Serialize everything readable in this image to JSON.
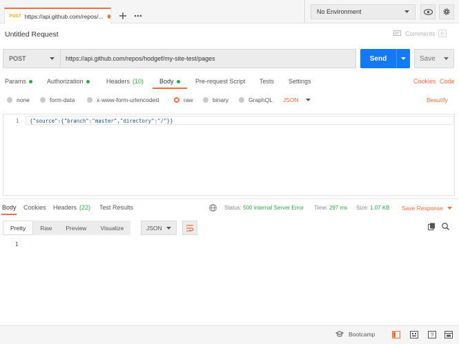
{
  "tabs": [
    {
      "method": "POST",
      "url": "https://api.github.com/repos/...",
      "unsaved": true
    }
  ],
  "environment": {
    "selected": "No Environment"
  },
  "request": {
    "title": "Untitled Request",
    "comments_label": "Comments",
    "comments_count": "0",
    "method": "POST",
    "url": "https://api.github.com/repos/hodgef/my-site-test/pages",
    "send_label": "Send",
    "save_label": "Save",
    "tabs": {
      "params": "Params",
      "authorization": "Authorization",
      "headers": "Headers",
      "headers_count": "(10)",
      "body": "Body",
      "pre_request": "Pre-request Script",
      "tests": "Tests",
      "settings": "Settings"
    },
    "cookies_label": "Cookies",
    "code_label": "Code",
    "body_types": [
      "none",
      "form-data",
      "x-www-form-urlencoded",
      "raw",
      "binary",
      "GraphQL"
    ],
    "body_type_selected": "raw",
    "raw_format": "JSON",
    "beautify_label": "Beautify",
    "body_line_number": "1",
    "body_text": "{\"source\":{\"branch\":\"master\",\"directory\":\"/\"}}"
  },
  "response": {
    "tabs": {
      "body": "Body",
      "cookies": "Cookies",
      "headers": "Headers",
      "headers_count": "(22)",
      "test_results": "Test Results"
    },
    "status_label": "Status:",
    "status_value": "500 Internal Server Error",
    "time_label": "Time:",
    "time_value": "297 ms",
    "size_label": "Size:",
    "size_value": "1.07 KB",
    "save_response_label": "Save Response",
    "view_modes": [
      "Pretty",
      "Raw",
      "Preview",
      "Visualize"
    ],
    "view_mode_selected": "Pretty",
    "format": "JSON",
    "line_number": "1"
  },
  "statusbar": {
    "bootcamp_label": "Bootcamp"
  },
  "colors": {
    "accent": "#f26b3a",
    "send": "#1479f5",
    "success": "#2ca744",
    "method_tab": "#f0ad00"
  }
}
